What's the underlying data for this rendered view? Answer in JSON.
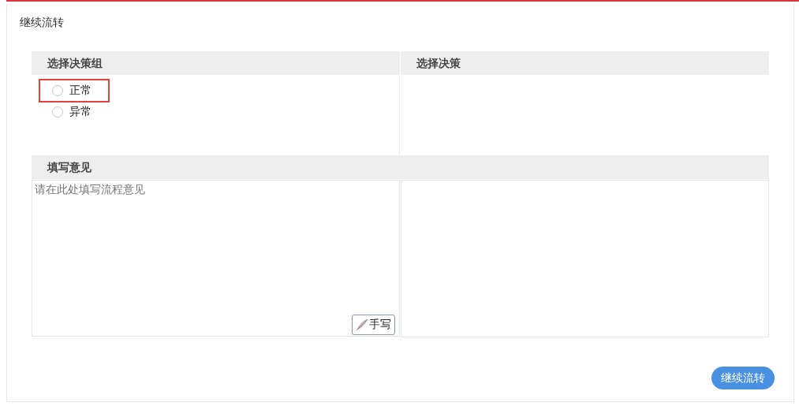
{
  "title": "继续流转",
  "decision_group": {
    "heading": "选择决策组",
    "options": [
      {
        "label": "正常",
        "selected": false,
        "highlighted": true
      },
      {
        "label": "异常",
        "selected": false,
        "highlighted": false
      }
    ]
  },
  "decision": {
    "heading": "选择决策"
  },
  "opinion": {
    "heading": "填写意见",
    "placeholder": "请在此处填写流程意见",
    "handwrite_button": "手写"
  },
  "submit_button": "继续流转"
}
